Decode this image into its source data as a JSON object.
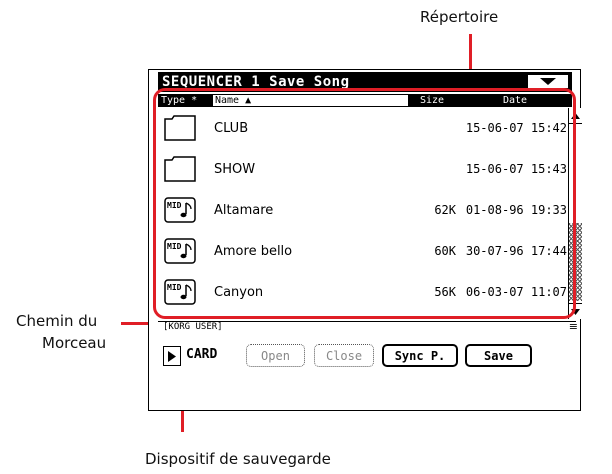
{
  "annotations": {
    "repertoire": "Répertoire",
    "song_path_line1": "Chemin du",
    "song_path_line2": "Morceau",
    "storage_device": "Dispositif de sauvegarde"
  },
  "window": {
    "title": "SEQUENCER 1  Save Song",
    "menu_icon": "triangle-down-icon"
  },
  "columns": {
    "type": "Type *",
    "name": "Name ▲",
    "size": "Size",
    "date": "Date"
  },
  "files": [
    {
      "type": "folder",
      "name": "CLUB",
      "size": "",
      "date": "15-06-07 15:42"
    },
    {
      "type": "folder",
      "name": "SHOW",
      "size": "",
      "date": "15-06-07 15:43"
    },
    {
      "type": "midi",
      "name": "Altamare",
      "size": "62K",
      "date": "01-08-96 19:33"
    },
    {
      "type": "midi",
      "name": "Amore bello",
      "size": "60K",
      "date": "30-07-96 17:44"
    },
    {
      "type": "midi",
      "name": "Canyon",
      "size": "56K",
      "date": "06-03-07 11:07"
    }
  ],
  "midi_icon_text": "MID",
  "scrollbar": {
    "position": 0.55
  },
  "path": "[KORG USER]",
  "device": "CARD",
  "buttons": {
    "open": "Open",
    "close": "Close",
    "sync": "Sync P.",
    "save": "Save"
  },
  "colors": {
    "callout": "#e01e26"
  }
}
